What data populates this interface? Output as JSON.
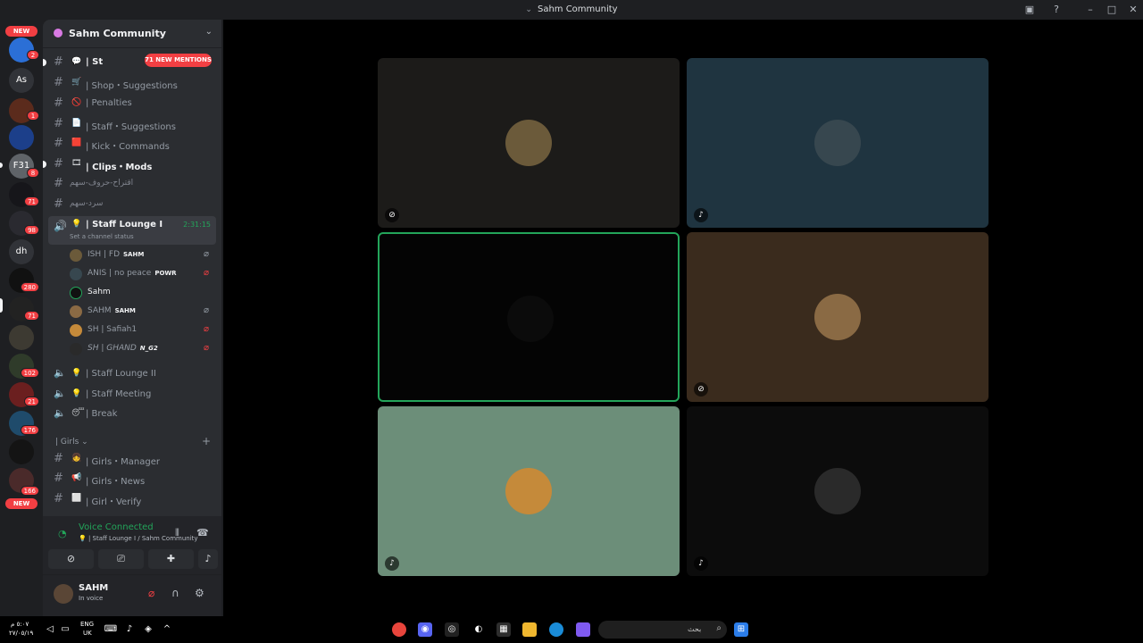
{
  "window": {
    "title": "Sahm Community"
  },
  "rail": {
    "new_top": "NEW",
    "new_bottom": "NEW",
    "servers": [
      {
        "initials": "",
        "badge": "2"
      },
      {
        "initials": "As",
        "badge": ""
      },
      {
        "initials": "",
        "badge": "1"
      },
      {
        "initials": "",
        "badge": ""
      },
      {
        "initials": "F31",
        "badge": "8"
      },
      {
        "initials": "",
        "badge": "71"
      },
      {
        "initials": "",
        "badge": "98"
      },
      {
        "initials": "dh",
        "badge": ""
      },
      {
        "initials": "",
        "badge": "280"
      },
      {
        "initials": "",
        "badge": "71"
      },
      {
        "initials": "",
        "badge": ""
      },
      {
        "initials": "",
        "badge": "102"
      },
      {
        "initials": "",
        "badge": "21"
      },
      {
        "initials": "",
        "badge": "176"
      },
      {
        "initials": "",
        "badge": ""
      },
      {
        "initials": "",
        "badge": "166"
      }
    ]
  },
  "guild": {
    "name": "Sahm Community",
    "mentions_pill": "71 NEW MENTIONS"
  },
  "channels": [
    {
      "emoji": "💬",
      "label": "| St",
      "bold": true
    },
    {
      "emoji": "🛒",
      "label": "| Shop・Suggestions",
      "bold": false
    },
    {
      "emoji": "🚫",
      "label": "| Penalties",
      "bold": false
    },
    {
      "emoji": "📄",
      "label": "| Staff・Suggestions",
      "bold": false
    },
    {
      "emoji": "🟥",
      "label": "| Kick・Commands",
      "bold": false
    },
    {
      "emoji": "🎞",
      "label": "| Clips・Mods",
      "bold": true
    },
    {
      "emoji": "",
      "label": "اقتراح-حروف-سهم",
      "bold": false
    },
    {
      "emoji": "",
      "label": "سرد-سهم",
      "bold": false
    }
  ],
  "voice": {
    "name": "| Staff Lounge I",
    "timer": "2:31:15",
    "status": "Set a channel status",
    "users": [
      {
        "name": "ISH | FD",
        "tag": "SAHM"
      },
      {
        "name": "ANIS | no peace",
        "tag": "POWR"
      },
      {
        "name": "Sahm",
        "tag": ""
      },
      {
        "name": "SAHM",
        "tag": "SAHM"
      },
      {
        "name": "SH | Safiah1",
        "tag": ""
      },
      {
        "name": "SH | GHAND",
        "tag": "N_G2"
      }
    ]
  },
  "voice_channels": [
    {
      "emoji": "💡",
      "label": "| Staff Lounge II"
    },
    {
      "emoji": "💡",
      "label": "| Staff Meeting"
    },
    {
      "emoji": "😴",
      "label": "| Break"
    }
  ],
  "category": {
    "name": "| Girls"
  },
  "girls_channels": [
    {
      "emoji": "👧",
      "label": "| Girls・Manager"
    },
    {
      "emoji": "📢",
      "label": "| Girls・News"
    },
    {
      "emoji": "⬜",
      "label": "| Girl・Verify"
    }
  ],
  "voice_panel": {
    "title": "Voice Connected",
    "subtitle": "💡 | Staff Lounge I / Sahm Community"
  },
  "userbar": {
    "name": "SAHM",
    "status": "In voice"
  },
  "tiles": [
    {
      "bg": "#1c1b19",
      "avatar": "#6b5a3a",
      "speaking": false,
      "indicator": "video-off-icon"
    },
    {
      "bg": "#1f3440",
      "avatar": "#37474f",
      "speaking": false,
      "indicator": "mic-icon"
    },
    {
      "bg": "#040404",
      "avatar": "#0b0b0b",
      "speaking": true,
      "indicator": ""
    },
    {
      "bg": "#3a2b1d",
      "avatar": "#8a6a44",
      "speaking": false,
      "indicator": "mic-off-icon"
    },
    {
      "bg": "#6c8e79",
      "avatar": "#c58a3a",
      "speaking": false,
      "indicator": "mic-icon"
    },
    {
      "bg": "#0c0c0c",
      "avatar": "#2a2a2a",
      "speaking": false,
      "indicator": "mic-icon"
    }
  ],
  "taskbar": {
    "time": "٥:٠٧ م",
    "date": "٢٧/٠٥/١٩",
    "lang_top": "ENG",
    "lang_bottom": "UK",
    "search_placeholder": "بحث"
  }
}
